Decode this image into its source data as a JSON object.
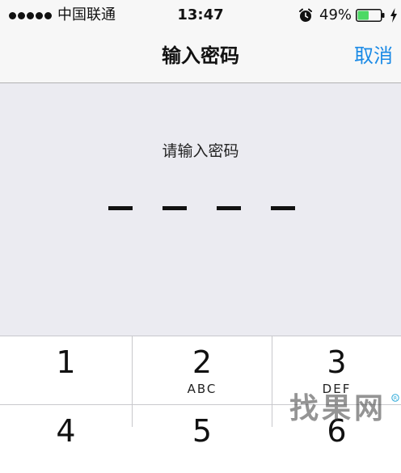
{
  "status_bar": {
    "carrier": "中国联通",
    "time": "13:47",
    "battery_percent": "49%",
    "battery_level": 0.49,
    "icons": [
      "signal-dots-icon",
      "alarm-clock-icon",
      "battery-icon",
      "charging-bolt-icon"
    ]
  },
  "nav": {
    "title": "输入密码",
    "cancel_label": "取消"
  },
  "passcode": {
    "prompt": "请输入密码",
    "digit_count": 4
  },
  "keypad": {
    "keys": [
      {
        "num": "1",
        "letters": ""
      },
      {
        "num": "2",
        "letters": "ABC"
      },
      {
        "num": "3",
        "letters": "DEF"
      },
      {
        "num": "4",
        "letters": ""
      },
      {
        "num": "5",
        "letters": ""
      },
      {
        "num": "6",
        "letters": ""
      }
    ]
  },
  "watermark": {
    "text": "找果网"
  },
  "colors": {
    "accent": "#1a8ae6",
    "battery_fill": "#4cd964",
    "passcode_bg": "#ebebf1",
    "bar_bg": "#f7f7f7"
  }
}
